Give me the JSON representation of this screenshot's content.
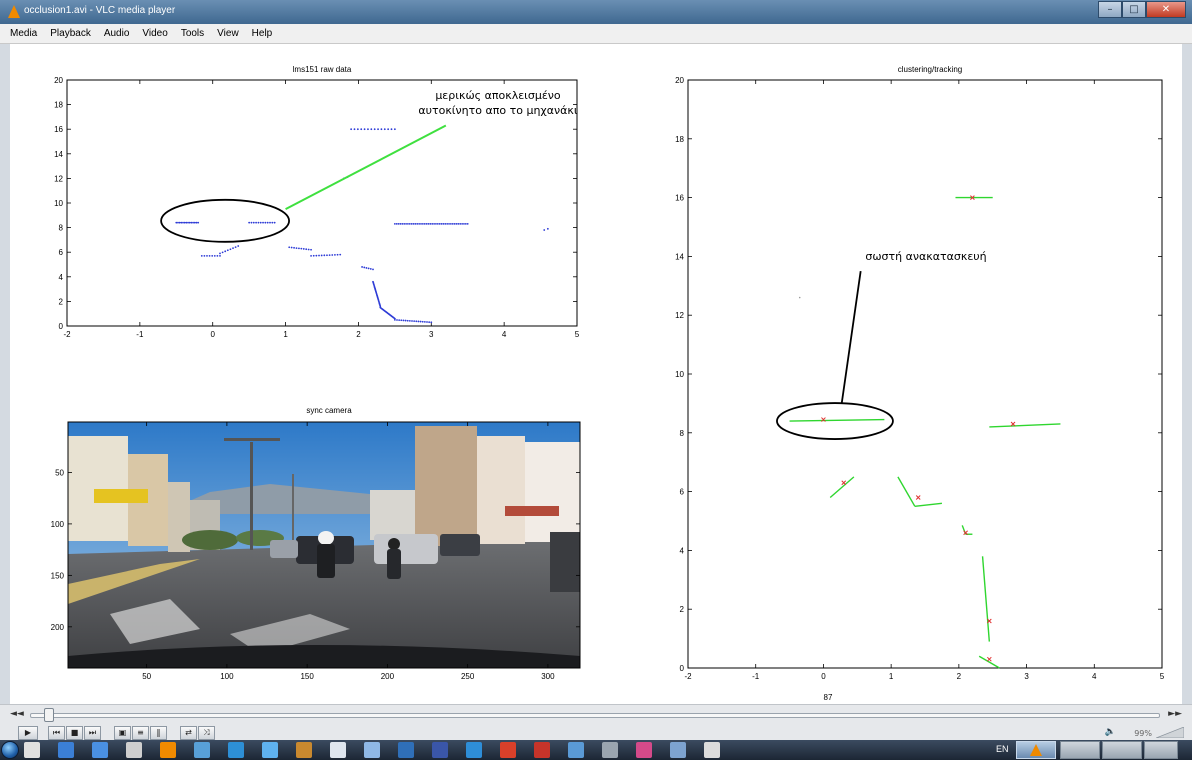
{
  "window": {
    "title": "occlusion1.avi - VLC media player",
    "minimize": "–",
    "maximize": "□",
    "close": "✕"
  },
  "menu": [
    "Media",
    "Playback",
    "Audio",
    "Video",
    "Tools",
    "View",
    "Help"
  ],
  "plots": {
    "raw": {
      "title": "lms151 raw data",
      "xticks": [
        "-2",
        "-1",
        "0",
        "1",
        "2",
        "3",
        "4",
        "5"
      ],
      "yticks": [
        "0",
        "2",
        "4",
        "6",
        "8",
        "10",
        "12",
        "14",
        "16",
        "18",
        "20"
      ],
      "xlim": [
        -2,
        5
      ],
      "ylim": [
        0,
        20
      ],
      "annotation_line1": "μερικώς αποκλεισμένο",
      "annotation_line2": "αυτοκίνητο απο το μηχανάκι",
      "point_color": "#2d3bd6",
      "arrow_color": "#3fe03f"
    },
    "tracking": {
      "title": "clustering/tracking",
      "xticks": [
        "-2",
        "-1",
        "0",
        "1",
        "2",
        "3",
        "4",
        "5"
      ],
      "yticks": [
        "0",
        "2",
        "4",
        "6",
        "8",
        "10",
        "12",
        "14",
        "16",
        "18",
        "20"
      ],
      "xlim": [
        -2,
        5
      ],
      "ylim": [
        0,
        20
      ],
      "annotation": "σωστή ανακατασκευή",
      "xlabel": "87",
      "segment_color": "#2fd62f",
      "centroid_color": "#e03030"
    },
    "camera": {
      "title": "sync camera",
      "xticks": [
        "50",
        "100",
        "150",
        "200",
        "250",
        "300"
      ],
      "yticks": [
        "50",
        "100",
        "150",
        "200"
      ],
      "xlim": [
        1,
        320
      ],
      "ylim": [
        1,
        240
      ]
    }
  },
  "controls": {
    "seek_back": "◄◄",
    "seek_forward": "►►",
    "buttons": [
      "▶",
      "⏮",
      "■",
      "⏭",
      "▣",
      "≡",
      "‖",
      "⇄",
      "⤨"
    ],
    "volume": "99%",
    "volume_icon": "speaker-icon",
    "seek_position": 0.012
  },
  "taskbar": {
    "language": "EN"
  },
  "colors": {
    "vlc_orange": "#f08a00",
    "title_blue": "#3f6890"
  }
}
